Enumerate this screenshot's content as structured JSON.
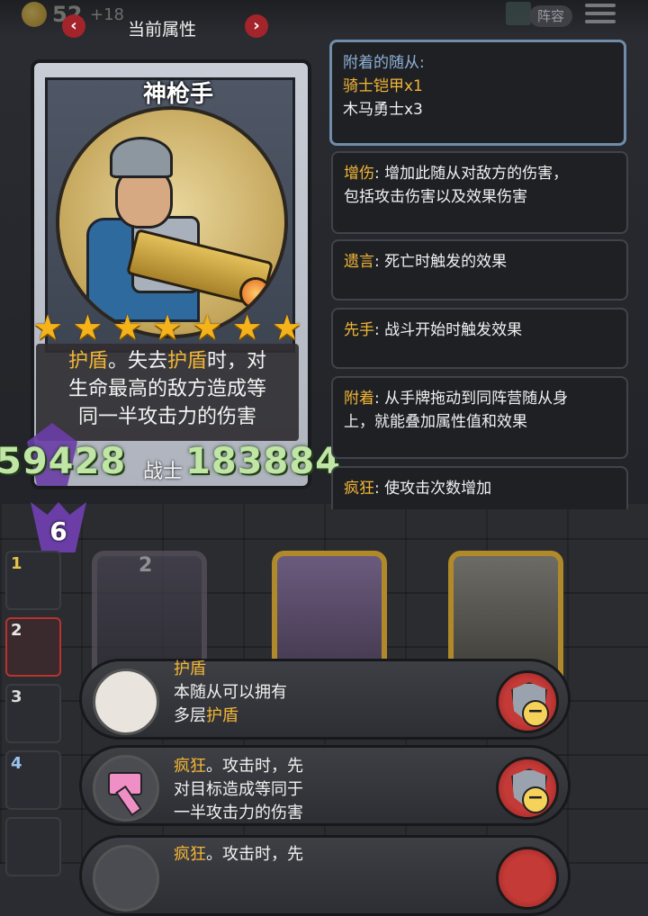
{
  "topbar": {
    "gold": "52",
    "gold_plus": "+18",
    "lineup_button": "阵容",
    "panel_title": "当前属性",
    "prev_arrow": "‹",
    "next_arrow": "›"
  },
  "hero": {
    "name": "神枪手",
    "stars": [
      "★",
      "★",
      "★",
      "★",
      "★",
      "★",
      "★"
    ],
    "ability_line1_kw": "护盾",
    "ability_line1_mid": "。失去",
    "ability_line1_kw2": "护盾",
    "ability_line1_end": "时，对",
    "ability_line2": "生命最高的敌方造成等",
    "ability_line3": "同一半攻击力的伤害",
    "stat_left": "59428",
    "stat_label": "战士",
    "stat_right": "183884",
    "level": "6"
  },
  "info_boxes": {
    "attached_title": "附着的随从:",
    "attached_item1": "骑士铠甲x1",
    "attached_item2": "木马勇士x3",
    "box2_kw": "增伤",
    "box2_text1": ": 增加此随从对敌方的伤害，",
    "box2_text2": "包括攻击伤害以及效果伤害",
    "box3_kw": "遗言",
    "box3_text": ": 死亡时触发的效果",
    "box4_kw": "先手",
    "box4_text": ": 战斗开始时触发效果",
    "box5_kw": "附着",
    "box5_text1": ": 从手牌拖动到同阵营随从身",
    "box5_text2": "上，就能叠加属性值和效果",
    "box6_kw": "疯狂",
    "box6_text": ": 使攻击次数增加"
  },
  "slots": [
    "1",
    "2",
    "3",
    "4"
  ],
  "minion_cost": "2",
  "keyword_rows": [
    {
      "kw": "护盾",
      "line2": "本随从可以拥有",
      "line3a": "多层",
      "line3b": "护盾"
    },
    {
      "kw": "疯狂",
      "line1b": "。攻击时，先",
      "line2": "对目标造成等同于",
      "line3": "一半攻击力的伤害"
    },
    {
      "kw": "疯狂",
      "line1b": "。攻击时，先"
    }
  ],
  "colors": {
    "keyword": "#f2b636",
    "stat_green": "#bfe6a4",
    "remove_red": "#c43a37"
  }
}
